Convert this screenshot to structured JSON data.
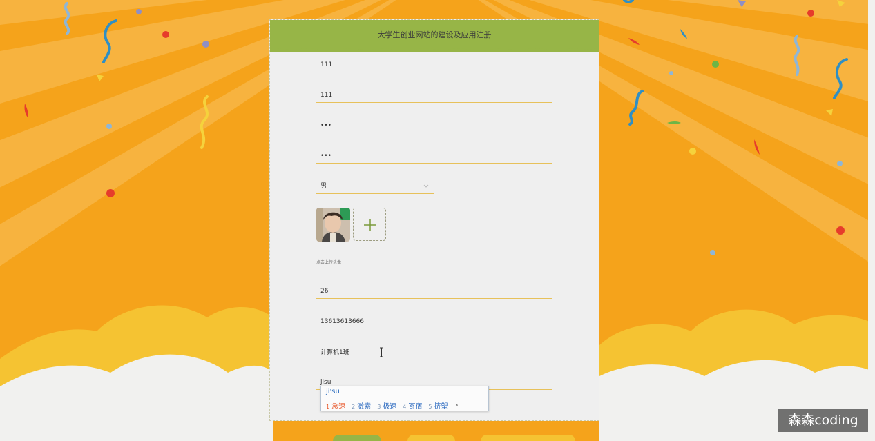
{
  "form": {
    "title": "大学生创业网站的建设及应用注册",
    "fields": {
      "account": "111",
      "name": "111",
      "password": "•••",
      "confirm_password": "•••",
      "gender": "男",
      "age": "26",
      "phone": "13613613666",
      "class_name": "计算机1班",
      "major": "jisu"
    },
    "upload_hint": "点击上传头像"
  },
  "ime": {
    "pinyin": "ji'su",
    "candidates": [
      {
        "num": "1",
        "word": "急速"
      },
      {
        "num": "2",
        "word": "激素"
      },
      {
        "num": "3",
        "word": "极速"
      },
      {
        "num": "4",
        "word": "寄宿"
      },
      {
        "num": "5",
        "word": "挤塑"
      }
    ],
    "next": "›"
  },
  "watermark": "森森coding",
  "icons": {
    "upload": "plus-icon",
    "select": "chevron-down-icon",
    "cursor": "text-cursor-icon",
    "ime_next": "chevron-right-icon"
  },
  "colors": {
    "header": "#97b547",
    "background": "#f5a31b",
    "field_underline": "#e7c15a",
    "ime_highlight": "#e8572a"
  }
}
